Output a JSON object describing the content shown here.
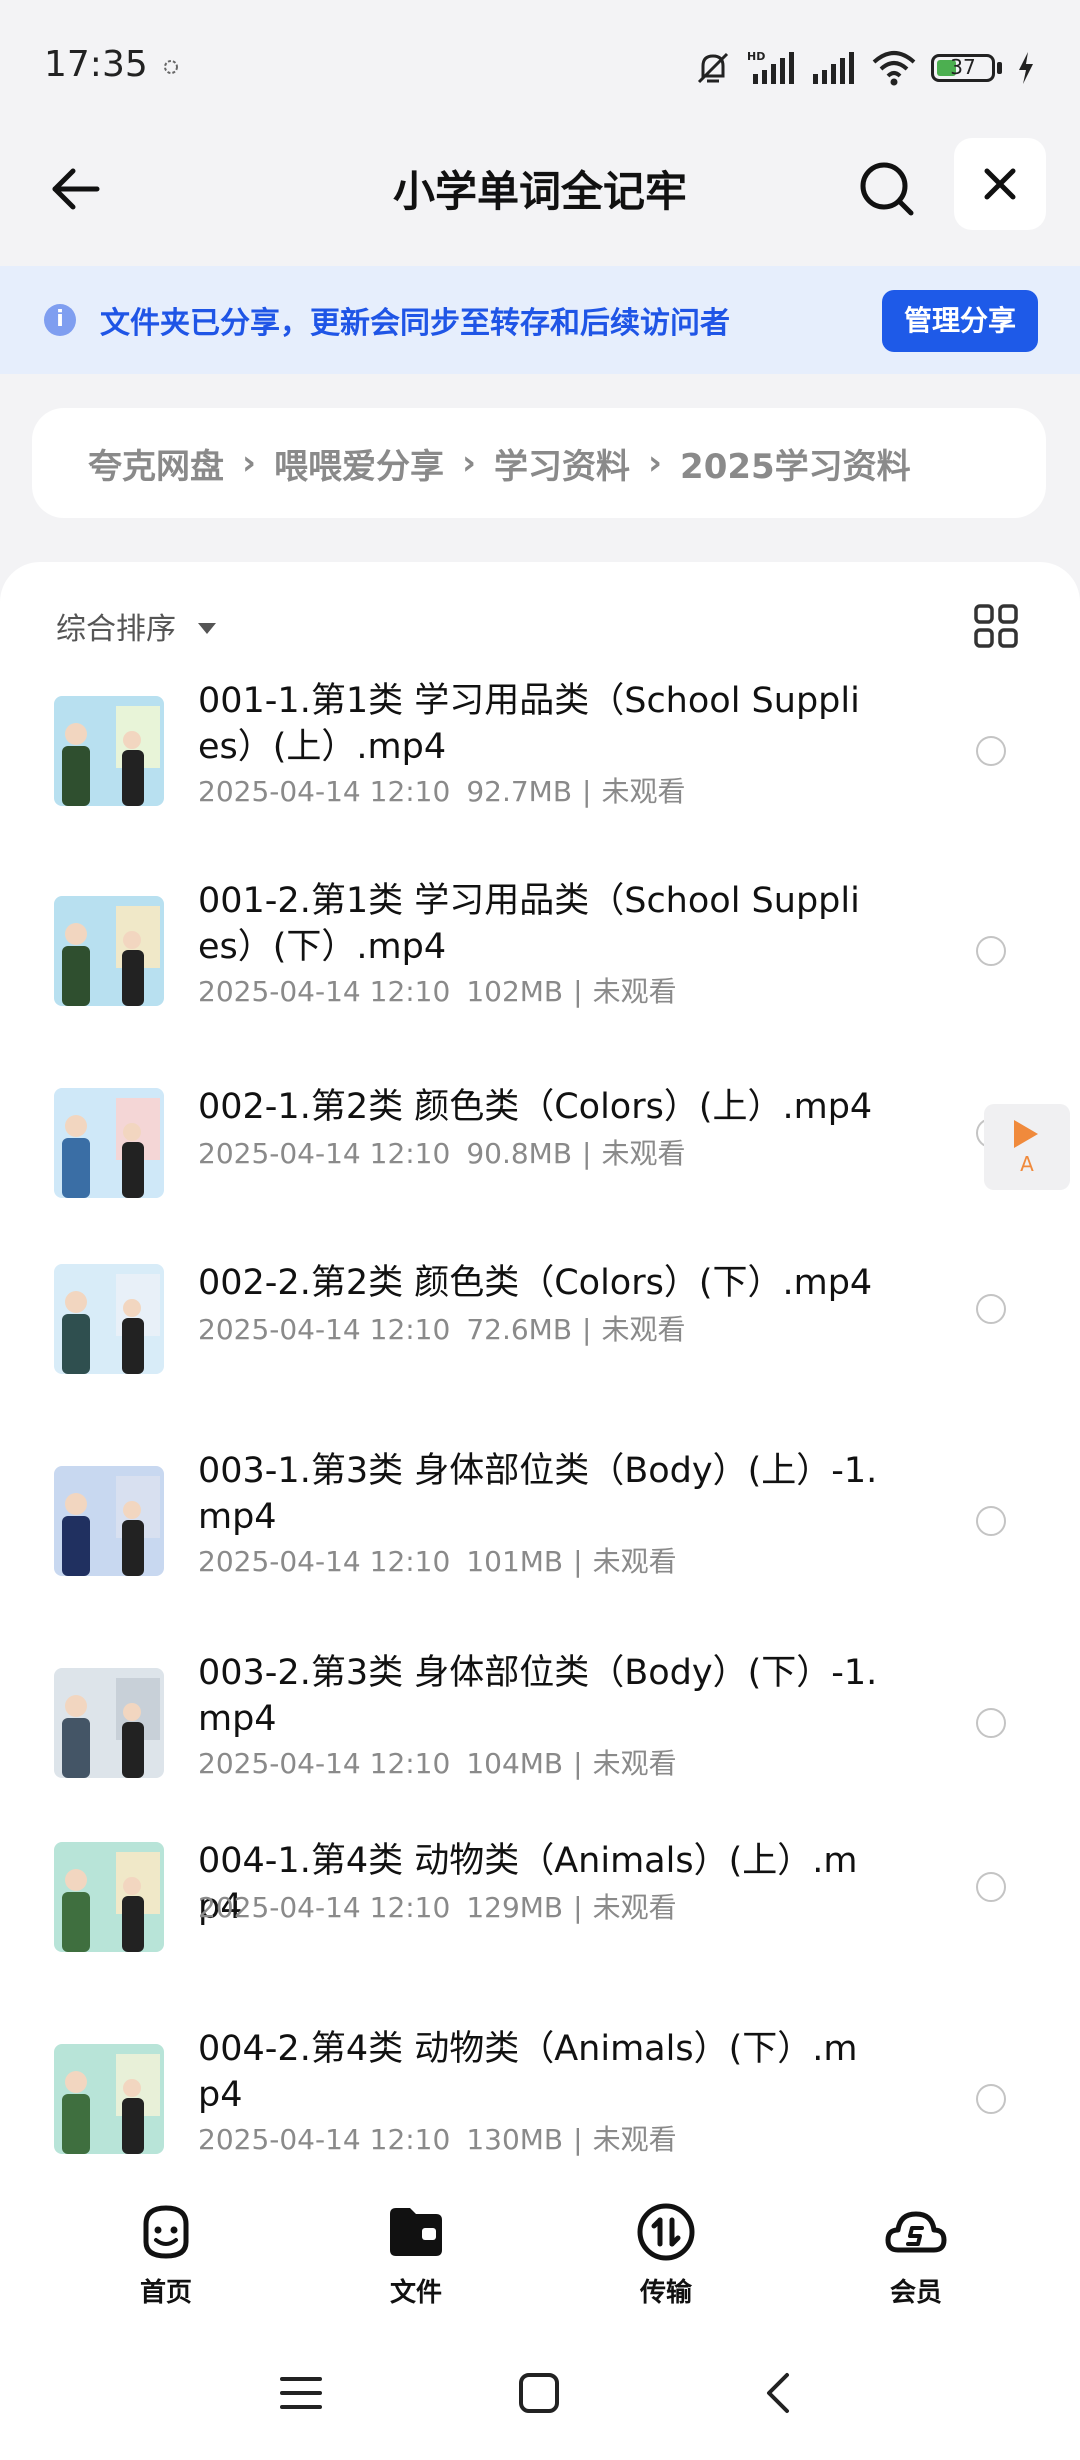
{
  "status_bar": {
    "time": "17:35",
    "battery_level": "37",
    "battery_fraction": 0.37,
    "icons": [
      "muted-bell-icon",
      "hd-signal-icon",
      "signal-icon",
      "wifi-icon",
      "battery-icon",
      "charging-bolt-icon"
    ]
  },
  "header": {
    "title": "小学单词全记牢",
    "back_icon": "arrow-left-icon",
    "search_icon": "search-icon",
    "close_icon": "close-icon"
  },
  "banner": {
    "text": "文件夹已分享，更新会同步至转存和后续访问者",
    "button_label": "管理分享",
    "icon": "info-icon"
  },
  "breadcrumb": {
    "items": [
      "夸克网盘",
      "喂喂爱分享",
      "学习资料",
      "2025学习资料"
    ],
    "separator": "›"
  },
  "toolbar": {
    "sort_label": "综合排序",
    "view_icon": "grid-view-icon"
  },
  "files": [
    {
      "name": "001-1.第1类 学习用品类（School Supplies）(上）.mp4",
      "date": "2025-04-14 12:10",
      "size": "92.7MB",
      "status": "未观看"
    },
    {
      "name": "001-2.第1类 学习用品类（School Supplies）(下）.mp4",
      "date": "2025-04-14 12:10",
      "size": "102MB",
      "status": "未观看"
    },
    {
      "name": "002-1.第2类 颜色类（Colors）(上）.mp4",
      "date": "2025-04-14 12:10",
      "size": "90.8MB",
      "status": "未观看"
    },
    {
      "name": "002-2.第2类 颜色类（Colors）(下）.mp4",
      "date": "2025-04-14 12:10",
      "size": "72.6MB",
      "status": "未观看"
    },
    {
      "name": "003-1.第3类 身体部位类（Body）(上）-1.mp4",
      "date": "2025-04-14 12:10",
      "size": "101MB",
      "status": "未观看"
    },
    {
      "name": "003-2.第3类 身体部位类（Body）(下）-1.mp4",
      "date": "2025-04-14 12:10",
      "size": "104MB",
      "status": "未观看"
    },
    {
      "name": "004-1.第4类 动物类（Animals）(上）.mp4",
      "date": "2025-04-14 12:10",
      "size": "129MB",
      "status": "未观看"
    },
    {
      "name": "004-2.第4类 动物类（Animals）(下）.mp4",
      "date": "2025-04-14 12:10",
      "size": "130MB",
      "status": "未观看"
    }
  ],
  "floating_button": {
    "label": "A",
    "icon": "play-icon"
  },
  "tabbar": {
    "tabs": [
      {
        "label": "首页",
        "icon": "smiley-home-icon"
      },
      {
        "label": "文件",
        "icon": "folder-icon"
      },
      {
        "label": "传输",
        "icon": "transfer-icon"
      },
      {
        "label": "会员",
        "icon": "vip-cloud-icon"
      }
    ]
  },
  "navbar": {
    "icons": [
      "menu-icon",
      "home-square-icon",
      "back-chevron-icon"
    ]
  },
  "colors": {
    "accent": "#1e5ae8",
    "banner_bg": "#e6eefc",
    "banner_text": "#1f55e6",
    "battery_green": "#4caf50",
    "float_orange": "#f08a3c"
  }
}
